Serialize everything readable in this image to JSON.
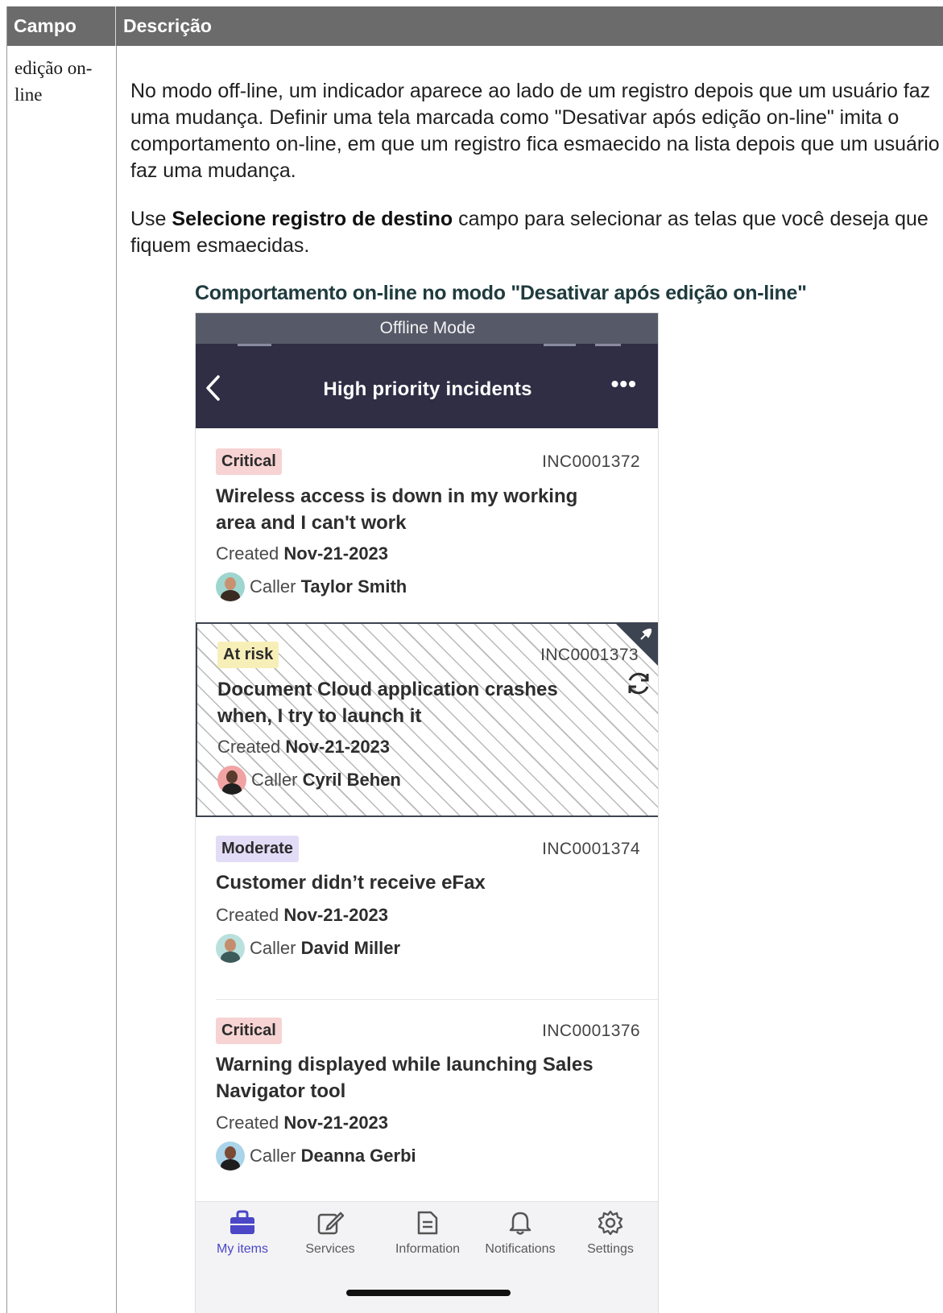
{
  "table": {
    "header_campo": "Campo",
    "header_descricao": "Descrição",
    "campo_value": "edição on-line",
    "para1": "No modo off-line, um indicador aparece ao lado de um registro depois que um usuário faz uma mudança. Definir uma tela marcada como \"Desativar após edição on-line\" imita o comportamento on-line, em que um registro fica esmaecido na lista depois que um usuário faz uma mudança.",
    "para2_prefix": "Use ",
    "para2_bold": "Selecione registro de destino",
    "para2_suffix": " campo para selecionar as telas que você deseja que fiquem esmaecidas.",
    "figure_caption": "Comportamento on-line no modo \"Desativar após edição on-line\""
  },
  "phone": {
    "offline_banner": "Offline Mode",
    "nav_title": "High priority incidents",
    "nav_back": "‹",
    "nav_more": "•••",
    "created_label": "Created",
    "caller_label": "Caller",
    "incidents": [
      {
        "priority": "Critical",
        "number": "INC0001372",
        "title": "Wireless access is down in my working area and I can't work",
        "created": "Nov-21-2023",
        "caller": "Taylor Smith",
        "badge_color": "#f7d3d3",
        "disabled": false
      },
      {
        "priority": "At risk",
        "number": "INC0001373",
        "title": "Document Cloud application crashes when, I try to launch it",
        "created": "Nov-21-2023",
        "caller": "Cyril Behen",
        "badge_color": "#f7efb8",
        "disabled": true
      },
      {
        "priority": "Moderate",
        "number": "INC0001374",
        "title": "Customer didn’t receive eFax",
        "created": "Nov-21-2023",
        "caller": "David Miller",
        "badge_color": "#e3dcf7",
        "disabled": false
      },
      {
        "priority": "Critical",
        "number": "INC0001376",
        "title": "Warning displayed while launching Sales Navigator tool",
        "created": "Nov-21-2023",
        "caller": "Deanna Gerbi",
        "badge_color": "#f7d3d3",
        "disabled": false
      }
    ],
    "tabs": [
      {
        "label": "My items",
        "icon": "briefcase-icon",
        "active": true
      },
      {
        "label": "Services",
        "icon": "edit-icon",
        "active": false
      },
      {
        "label": "Information",
        "icon": "document-icon",
        "active": false
      },
      {
        "label": "Notifications",
        "icon": "bell-icon",
        "active": false
      },
      {
        "label": "Settings",
        "icon": "gear-icon",
        "active": false
      }
    ],
    "accent_color": "#4b47c7",
    "nav_color": "#2f2e45"
  }
}
